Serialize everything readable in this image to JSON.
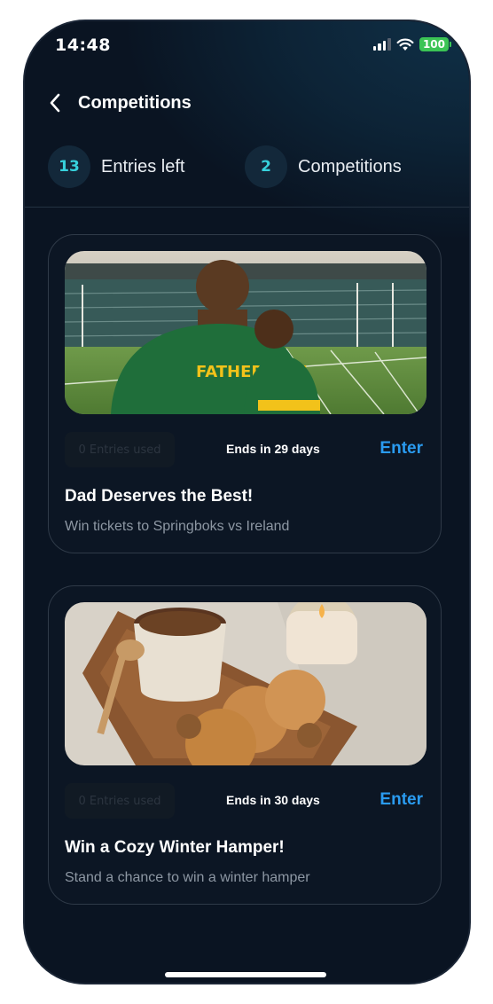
{
  "status_bar": {
    "time": "14:48",
    "battery": "100"
  },
  "header": {
    "title": "Competitions"
  },
  "stats": [
    {
      "count": "13",
      "label": "Entries left"
    },
    {
      "count": "2",
      "label": "Competitions"
    }
  ],
  "cards": [
    {
      "image": "father-son-stadium-photo",
      "entries_used": "0 Entries used",
      "ends": "Ends in 29 days",
      "enter": "Enter",
      "title": "Dad Deserves the Best!",
      "subtitle": "Win tickets to Springboks vs Ireland",
      "jersey_text": "FATHER SON"
    },
    {
      "image": "cozy-tea-cookies-photo",
      "entries_used": "0 Entries used",
      "ends": "Ends in 30 days",
      "enter": "Enter",
      "title": "Win a Cozy Winter Hamper!",
      "subtitle": "Stand a chance to win a winter hamper"
    }
  ],
  "colors": {
    "accent": "#2a9bf0",
    "stat_number": "#37d1dc",
    "background": "#0a1422"
  }
}
